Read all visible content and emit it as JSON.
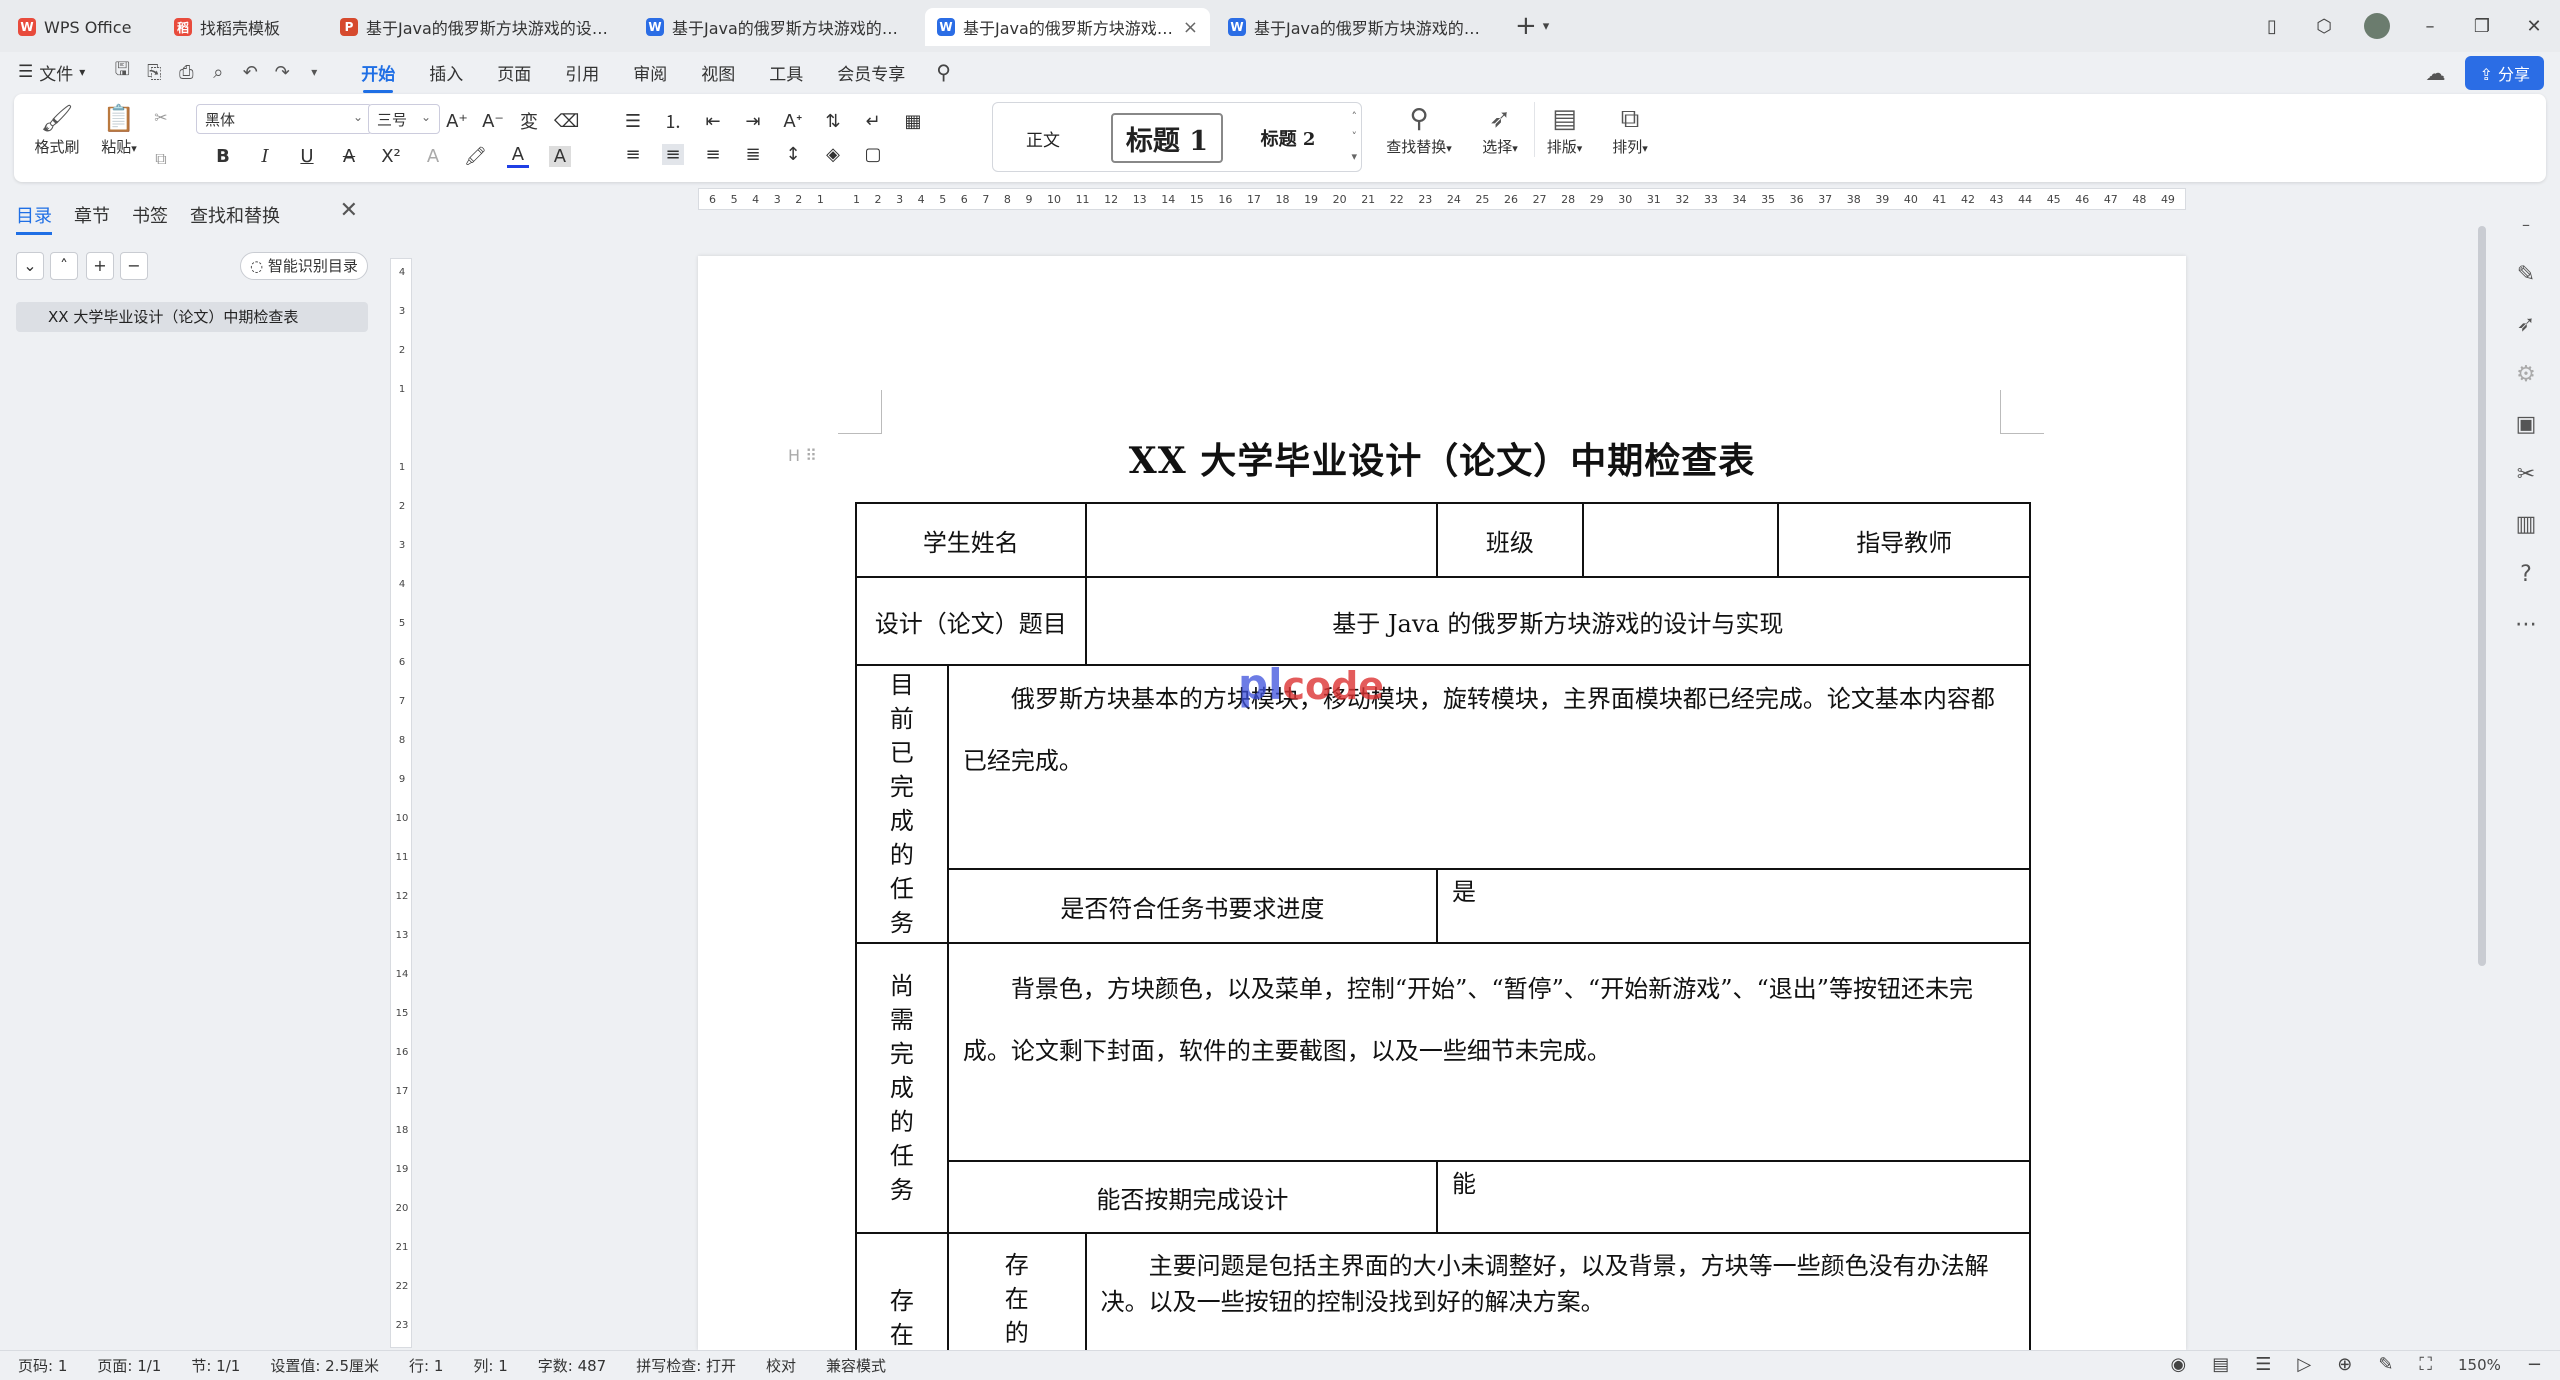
{
  "tabs": [
    {
      "label": "WPS Office",
      "icon": "wps-logo-icon",
      "color": "#e84b3c"
    },
    {
      "label": "找稻壳模板",
      "icon": "docer-icon",
      "color": "#e84b3c"
    },
    {
      "label": "基于Java的俄罗斯方块游戏的设计与实现",
      "icon": "ppt-icon",
      "color": "#d64a2e"
    },
    {
      "label": "基于Java的俄罗斯方块游戏的设计与实现",
      "icon": "word-icon",
      "color": "#2b6de5"
    },
    {
      "label": "基于Java的俄罗斯方块游戏的设计与实现",
      "icon": "word-icon",
      "color": "#2b6de5",
      "active": true
    },
    {
      "label": "基于Java的俄罗斯方块游戏的设计与实现",
      "icon": "word-icon",
      "color": "#2b6de5"
    }
  ],
  "menu": {
    "file": "文件",
    "tabs": [
      "开始",
      "插入",
      "页面",
      "引用",
      "审阅",
      "视图",
      "工具",
      "会员专享"
    ],
    "active_tab": "开始",
    "share": "分享"
  },
  "ribbon": {
    "format_painter": "格式刷",
    "paste": "粘贴",
    "font_name": "黑体",
    "font_size": "三号",
    "styles": {
      "normal": "正文",
      "h1": "标题 1",
      "h2": "标题 2"
    },
    "find_replace": "查找替换",
    "select": "选择",
    "typeset": "排版",
    "arrange": "排列"
  },
  "nav": {
    "tabs": [
      "目录",
      "章节",
      "书签",
      "查找和替换"
    ],
    "active_tab": "目录",
    "smart_toc": "智能识别目录",
    "toc_item": "XX 大学毕业设计（论文）中期检查表"
  },
  "ruler": {
    "h_ticks": [
      "6",
      "5",
      "4",
      "3",
      "2",
      "1",
      "",
      "1",
      "2",
      "3",
      "4",
      "5",
      "6",
      "7",
      "8",
      "9",
      "10",
      "11",
      "12",
      "13",
      "14",
      "15",
      "16",
      "17",
      "18",
      "19",
      "20",
      "21",
      "22",
      "23",
      "24",
      "25",
      "26",
      "27",
      "28",
      "29",
      "30",
      "31",
      "32",
      "33",
      "34",
      "35",
      "36",
      "37",
      "38",
      "39",
      "40",
      "41",
      "42",
      "43",
      "44",
      "45",
      "46",
      "47",
      "48",
      "49"
    ],
    "v_ticks": [
      "4",
      "3",
      "2",
      "1",
      "",
      "1",
      "2",
      "3",
      "4",
      "5",
      "6",
      "7",
      "8",
      "9",
      "10",
      "11",
      "12",
      "13",
      "14",
      "15",
      "16",
      "17",
      "18",
      "19",
      "20",
      "21",
      "22",
      "23"
    ]
  },
  "document": {
    "heading_marker": "H",
    "title": "XX 大学毕业设计（论文）中期检查表",
    "student_name_label": "学生姓名",
    "class_label": "班级",
    "advisor_label": "指导教师",
    "topic_label": "设计（论文）题目",
    "topic_value": "基于 Java 的俄罗斯方块游戏的设计与实现",
    "done_label": [
      "目",
      "前",
      "已",
      "完",
      "成",
      "的",
      "任",
      "务"
    ],
    "done_text": "俄罗斯方块基本的方块模块，移动模块，旋转模块，主界面模块都已经完成。论文基本内容都已经完成。",
    "progress_label": "是否符合任务书要求进度",
    "progress_value": "是",
    "todo_label": [
      "尚",
      "需",
      "完",
      "成",
      "的",
      "任",
      "务"
    ],
    "todo_text": "背景色，方块颜色，以及菜单，控制“开始”、“暂停”、“开始新游戏”、“退出”等按钮还未完成。论文剩下封面，软件的主要截图，以及一些细节未完成。",
    "ontime_label": "能否按期完成设计",
    "ontime_value": "能",
    "issues_outer_label": [
      "存",
      "在"
    ],
    "issues_inner_label": [
      "存",
      "在",
      "的"
    ],
    "issues_text": "主要问题是包括主界面的大小未调整好，以及背景，方块等一些颜色没有办法解决。以及一些按钮的控制没找到好的解决方案。",
    "watermark_a": "pl",
    "watermark_b": "code"
  },
  "status": {
    "page": "页码: 1",
    "pages": "页面: 1/1",
    "section": "节: 1/1",
    "position": "设置值: 2.5厘米",
    "row": "行: 1",
    "col": "列: 1",
    "word_count": "字数: 487",
    "spell_check": "拼写检查: 打开",
    "proof": "校对",
    "compat": "兼容模式",
    "zoom": "150%"
  },
  "colors": {
    "accent": "#1f6fe5",
    "share": "#2b6de5"
  }
}
